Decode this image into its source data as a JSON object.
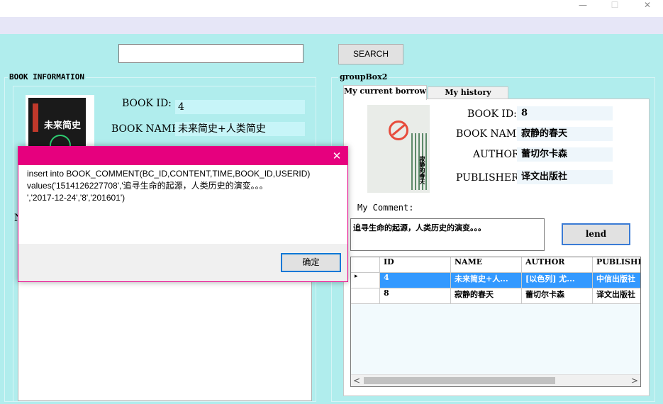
{
  "window": {
    "minimize_glyph": "—",
    "maximize_glyph": "☐",
    "close_glyph": "✕"
  },
  "search": {
    "value": "",
    "button_label": "SEARCH"
  },
  "left_group": {
    "title": "BOOK INFORMATION",
    "book_id_label": "BOOK ID:",
    "book_id_value": "4",
    "book_name_label": "BOOK NAME:",
    "book_name_value": "未来简史+人类简史",
    "cover_text": "未来简史",
    "hidden_char": "N"
  },
  "right_group": {
    "title": "groupBox2",
    "tabs": [
      {
        "label": "My current borrow",
        "active": true
      },
      {
        "label": "My history borrow",
        "active": false
      }
    ],
    "book_id_label": "BOOK ID:",
    "book_id_value": "8",
    "book_name_label": "BOOK NAME:",
    "book_name_value": "寂静的春天",
    "author_label": "AUTHOR:",
    "author_value": "蕾切尔卡森",
    "publisher_label": "PUBLISHER:",
    "publisher_value": "译文出版社",
    "cover_text": "寂静的春天",
    "comment_label": "My Comment:",
    "comment_value": "追寻生命的起源，人类历史的演变。。。",
    "lend_label": "lend"
  },
  "grid": {
    "columns": [
      "ID",
      "NAME",
      "AUTHOR",
      "PUBLISHER"
    ],
    "rows": [
      [
        "4",
        "未来简史+人...",
        "[以色列] 尤...",
        "中信出版社"
      ],
      [
        "8",
        "寂静的春天",
        "蕾切尔卡森",
        "译文出版社"
      ]
    ],
    "selected_row": 0,
    "row_indicator": "▸",
    "scroll_left": "<",
    "scroll_right": ">"
  },
  "dialog": {
    "close_glyph": "✕",
    "message": "insert into BOOK_COMMENT(BC_ID,CONTENT,TIME,BOOK_ID,USERID)\nvalues('1514126227708','追寻生命的起源，人类历史的演变。。。\n','2017-12-24','8','201601')",
    "ok_label": "确定"
  },
  "colors": {
    "client_bg": "#b0eded",
    "menubar_bg": "#e6e6f7",
    "dialog_title": "#e6007e",
    "selection": "#3399ff",
    "field_bg": "#c7f5f8"
  }
}
